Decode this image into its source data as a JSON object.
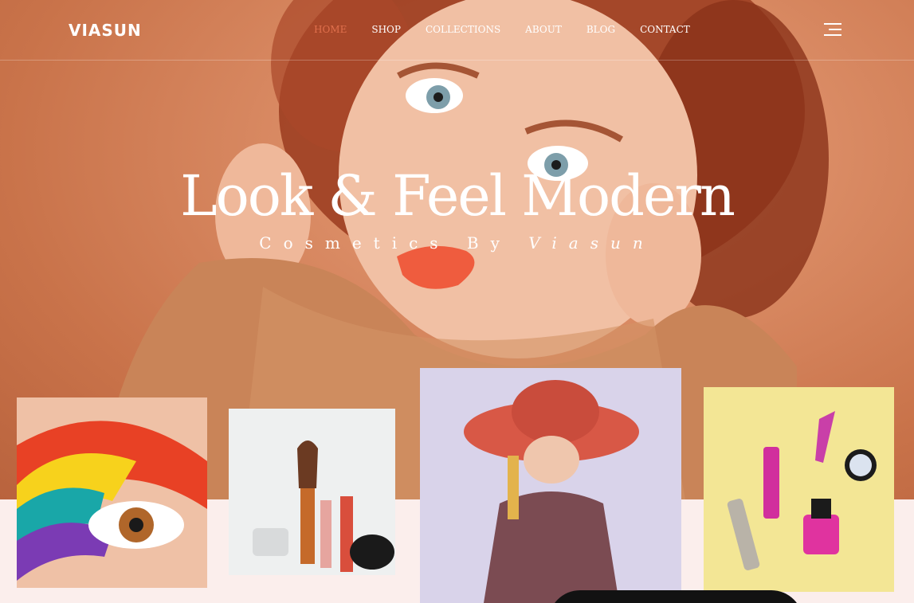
{
  "brand": {
    "logo": "VIASUN"
  },
  "nav": {
    "items": [
      {
        "label": "HOME",
        "active": true
      },
      {
        "label": "SHOP",
        "active": false
      },
      {
        "label": "COLLECTIONS",
        "active": false
      },
      {
        "label": "ABOUT",
        "active": false
      },
      {
        "label": "BLOG",
        "active": false
      },
      {
        "label": "CONTACT",
        "active": false
      }
    ],
    "menu_icon": "hamburger-icon"
  },
  "hero": {
    "title": "Look & Feel Modern",
    "subtitle_prefix": "Cosmetics By ",
    "subtitle_brand": "Viasun"
  },
  "gallery": [
    {
      "name": "rainbow-eye-makeup"
    },
    {
      "name": "cosmetic-products"
    },
    {
      "name": "woman-in-red-hat"
    },
    {
      "name": "makeup-flatlay"
    }
  ],
  "colors": {
    "accent": "#e0704d",
    "hero_bg": "#d98a63",
    "page_bg": "#fbeeec"
  }
}
